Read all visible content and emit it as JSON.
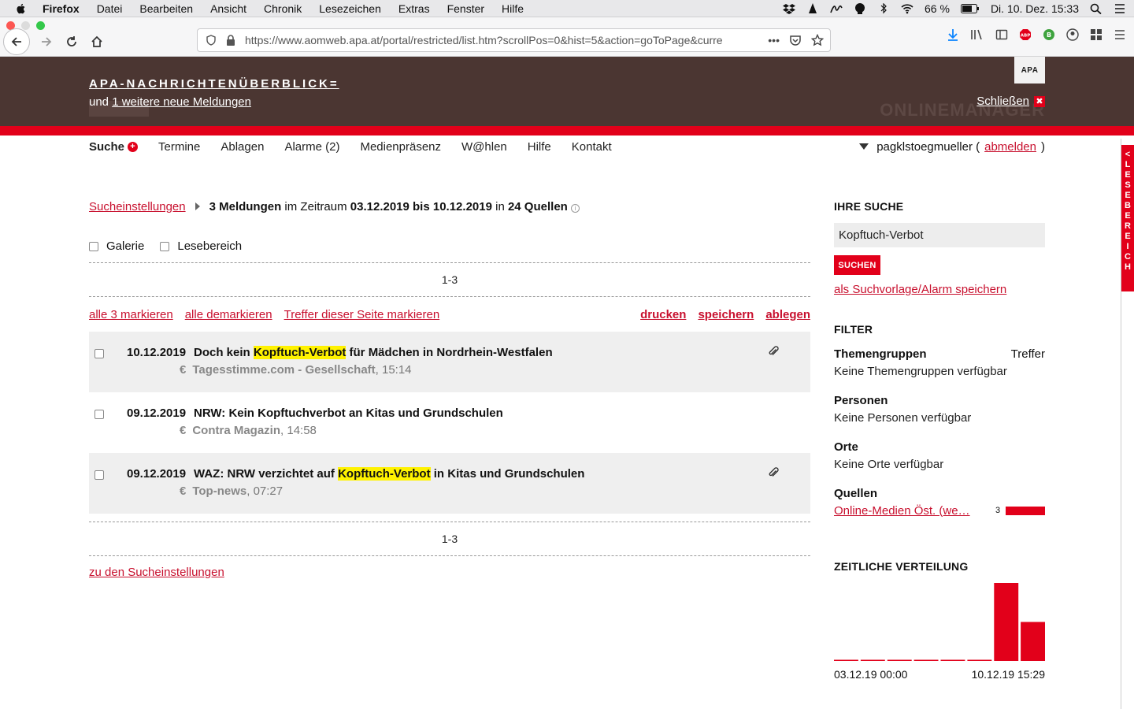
{
  "os_menu": {
    "app": "Firefox",
    "items": [
      "Datei",
      "Bearbeiten",
      "Ansicht",
      "Chronik",
      "Lesezeichen",
      "Extras",
      "Fenster",
      "Hilfe"
    ],
    "battery": "66 %",
    "clock": "Di. 10. Dez.  15:33"
  },
  "browser": {
    "url": "https://www.aomweb.apa.at/portal/restricted/list.htm?scrollPos=0&hist=5&action=goToPage&curre",
    "overflow_label": "•••"
  },
  "header": {
    "title": "APA-NACHRICHTENÜBERBLICK=",
    "subline_prefix": "und ",
    "subline_link": "1 weitere neue Meldungen",
    "logo": "APA",
    "close_label": "Schließen",
    "close_glyph": "✖",
    "watermark": "ONLINEMANAGER"
  },
  "nav": {
    "active": "Suche",
    "plus_glyph": "+",
    "items": [
      "Termine",
      "Ablagen",
      "Alarme (2)",
      "Medienpräsenz",
      "W@hlen",
      "Hilfe",
      "Kontakt"
    ],
    "user": "pagklstoegmueller (",
    "logout": "abmelden",
    "user_close": ")"
  },
  "results": {
    "crumb_link": "Sucheinstellungen",
    "count": "3 Meldungen",
    "mid1": " im Zeitraum ",
    "range": "03.12.2019 bis 10.12.2019",
    "mid2": " in ",
    "sources": "24 Quellen",
    "info_glyph": "i",
    "galerie": "Galerie",
    "lesebereich": "Lesebereich",
    "pager": "1-3",
    "mark_all": "alle 3 markieren",
    "unmark_all": "alle demarkieren",
    "mark_page": "Treffer dieser Seite markieren",
    "print": "drucken",
    "save": "speichern",
    "file": "ablegen",
    "back_link": "zu den Sucheinstellungen",
    "euro": "€",
    "hits": [
      {
        "date": "10.12.2019",
        "pre": "Doch kein ",
        "hl": "Kopftuch-Verbot",
        "post": " für Mädchen in Nordrhein-Westfalen",
        "source": "Tagesstimme.com - Gesellschaft",
        "time": ", 15:14",
        "attachment": true
      },
      {
        "date": "09.12.2019",
        "pre": "NRW: Kein Kopftuchverbot an Kitas und Grundschulen",
        "hl": "",
        "post": "",
        "source": "Contra Magazin",
        "time": ", 14:58",
        "attachment": false
      },
      {
        "date": "09.12.2019",
        "pre": "WAZ: NRW verzichtet auf ",
        "hl": "Kopftuch-Verbot",
        "post": " in Kitas und Grundschulen",
        "source": "Top-news",
        "time": ", 07:27",
        "attachment": true
      }
    ]
  },
  "sidebar": {
    "search_heading": "IHRE SUCHE",
    "search_value": "Kopftuch-Verbot",
    "search_button": "SUCHEN",
    "save_link": "als Suchvorlage/Alarm speichern",
    "filter_heading": "FILTER",
    "themen_heading": "Themengruppen",
    "treffer_label": "Treffer",
    "themen_value": "Keine Themengruppen verfügbar",
    "personen_heading": "Personen",
    "personen_value": "Keine Personen verfügbar",
    "orte_heading": "Orte",
    "orte_value": "Keine Orte verfügbar",
    "quellen_heading": "Quellen",
    "quellen_item": "Online-Medien Öst. (we…",
    "quellen_count": "3",
    "zv_heading": "ZEITLICHE VERTEILUNG",
    "zv_start": "03.12.19 00:00",
    "zv_end": "10.12.19 15:29"
  },
  "lesetab": {
    "arrow": "<",
    "letters": [
      "L",
      "E",
      "S",
      "E",
      "B",
      "E",
      "R",
      "E",
      "I",
      "C",
      "H"
    ]
  },
  "chart_data": {
    "type": "bar",
    "categories": [
      "1",
      "2",
      "3",
      "4",
      "5",
      "6",
      "7",
      "8"
    ],
    "values": [
      0,
      0,
      0,
      0,
      0,
      0,
      2,
      1
    ],
    "ylim": [
      0,
      2
    ],
    "color": "#e2001a",
    "xlabel": "",
    "ylabel": ""
  },
  "colors": {
    "accent": "#e2001a",
    "header_bg": "#4b3632",
    "link": "#c8102e",
    "highlight": "#fff200"
  }
}
